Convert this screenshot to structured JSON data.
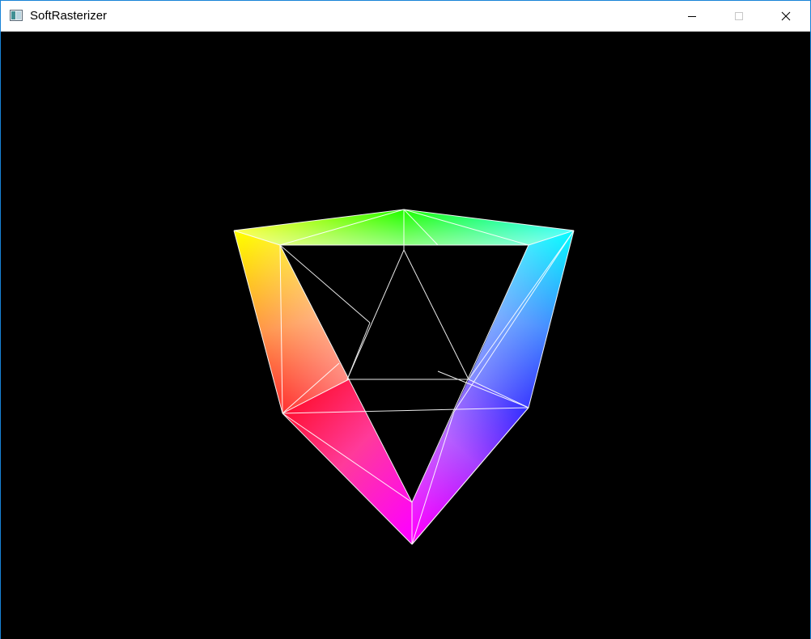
{
  "window": {
    "title": "SoftRasterizer",
    "app_icon": "app-window-icon",
    "controls": [
      "minimize-icon",
      "maximize-icon",
      "close-icon"
    ]
  },
  "viewport": {
    "background": "#000000",
    "render": {
      "description_colors": [
        "#ffff00",
        "#00ff00",
        "#00ffff",
        "#0000ff",
        "#ff00ff",
        "#ff0000"
      ],
      "wireframe_color": "#ffffff"
    }
  }
}
